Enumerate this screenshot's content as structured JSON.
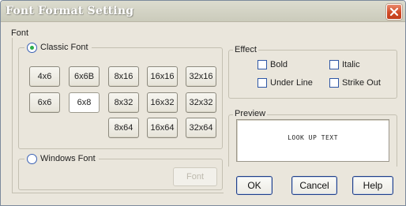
{
  "window": {
    "title": "Font Format Setting"
  },
  "font_group": {
    "label": "Font",
    "classic": {
      "label": "Classic Font",
      "selected": true,
      "buttons": [
        {
          "label": "4x6",
          "selected": false
        },
        {
          "label": "6x6B",
          "selected": false
        },
        {
          "label": "8x16",
          "selected": false
        },
        {
          "label": "16x16",
          "selected": false
        },
        {
          "label": "32x16",
          "selected": false
        },
        {
          "label": "6x6",
          "selected": false
        },
        {
          "label": "6x8",
          "selected": true
        },
        {
          "label": "8x32",
          "selected": false
        },
        {
          "label": "16x32",
          "selected": false
        },
        {
          "label": "32x32",
          "selected": false
        },
        {
          "label": "8x64",
          "selected": false
        },
        {
          "label": "16x64",
          "selected": false
        },
        {
          "label": "32x64",
          "selected": false
        }
      ]
    },
    "windows": {
      "label": "Windows Font",
      "selected": false,
      "font_button": "Font"
    }
  },
  "effect": {
    "label": "Effect",
    "options": [
      {
        "label": "Bold",
        "checked": false
      },
      {
        "label": "Italic",
        "checked": false
      },
      {
        "label": "Under Line",
        "checked": false
      },
      {
        "label": "Strike Out",
        "checked": false
      }
    ]
  },
  "preview": {
    "label": "Preview",
    "text": "LOOK UP TEXT"
  },
  "buttons": {
    "ok": "OK",
    "cancel": "Cancel",
    "help": "Help"
  },
  "colors": {
    "title_bar": "#cbcbbb",
    "close_button": "#d04a26",
    "dialog_bg": "#eae6dc",
    "radio_dot": "#2cae4a",
    "button_border": "#1f3f8a"
  }
}
